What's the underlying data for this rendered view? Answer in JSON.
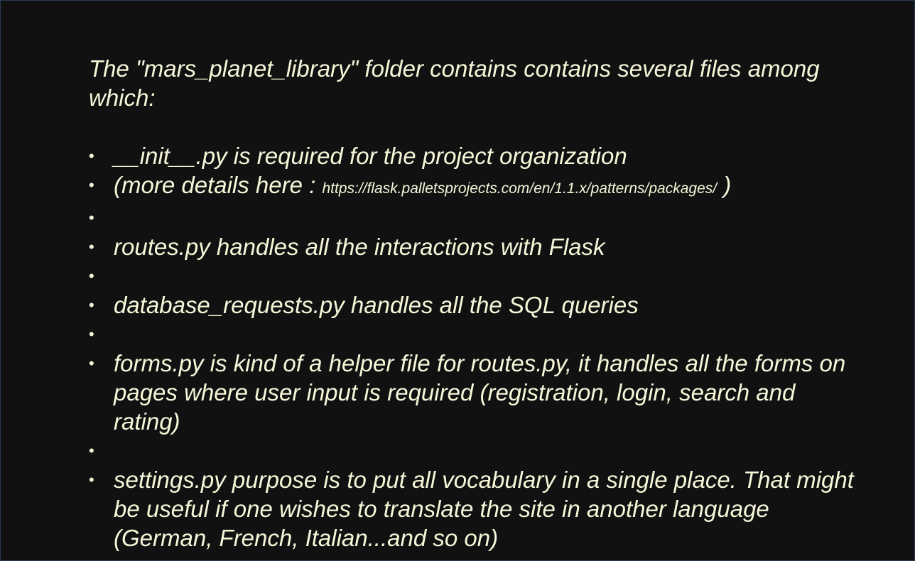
{
  "intro": {
    "text": "The \"mars_planet_library\" folder contains contains several files among which:"
  },
  "bullet_char": "•",
  "items": [
    {
      "text": "__init__.py is required for the project organization"
    },
    {
      "prefix": "(more details here : ",
      "url": "https://flask.palletsprojects.com/en/1.1.x/patterns/packages/",
      "suffix": " )"
    },
    {
      "text": ""
    },
    {
      "text": "routes.py handles all the interactions with Flask"
    },
    {
      "text": ""
    },
    {
      "text": "database_requests.py handles all the SQL queries"
    },
    {
      "text": ""
    },
    {
      "text": "forms.py is kind of a helper file for routes.py, it handles all the forms on pages where user input is required (registration, login, search and rating)"
    },
    {
      "text": ""
    },
    {
      "text": "settings.py purpose is to put all vocabulary in a single place. That might be useful if one wishes to translate the site in another language (German, French, Italian...and so on)"
    }
  ],
  "colors": {
    "background": "#111111",
    "text": "#f6f6d9"
  }
}
